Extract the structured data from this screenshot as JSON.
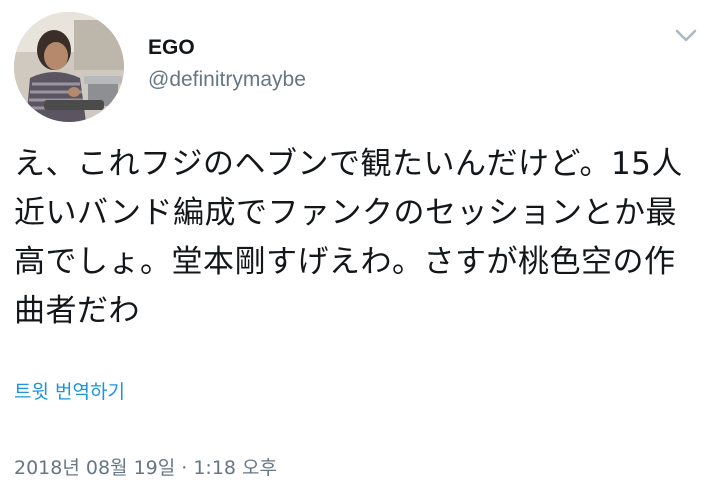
{
  "tweet": {
    "author": {
      "display_name": "EGO",
      "handle": "@definitrymaybe",
      "avatar_icon": "profile-photo"
    },
    "menu_icon": "chevron-down-icon",
    "text": "え、これフジのヘブンで観たいんだけど。15人近いバンド編成でファンクのセッションとか最高でしょ。堂本剛すげえわ。さすが桃色空の作曲者だわ",
    "translate_label": "트윗 번역하기",
    "timestamp": "2018년 08월 19일 · 1:18 오후"
  },
  "colors": {
    "text": "#14171a",
    "secondary": "#657786",
    "link": "#1b95e0",
    "caret": "#aab8c2"
  }
}
